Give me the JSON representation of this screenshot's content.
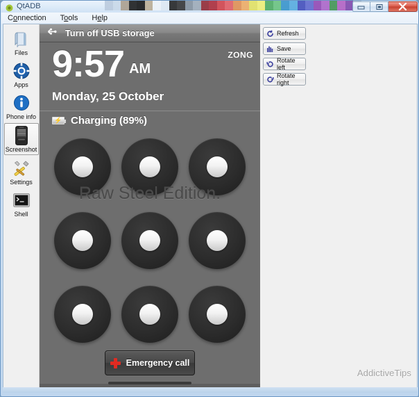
{
  "window": {
    "title": "QtADB",
    "app_icon": "android-icon",
    "controls": [
      {
        "name": "minimize",
        "icon": "minimize-icon"
      },
      {
        "name": "maximize",
        "icon": "maximize-icon"
      },
      {
        "name": "close",
        "icon": "close-icon"
      }
    ],
    "artifact_colors": [
      "#b9c9dc",
      "#c8d8e8",
      "#a89a88",
      "#121212",
      "#0a0a0a",
      "#b8a98f",
      "#eef3f8",
      "#dfe8f2",
      "#1a1a1a",
      "#2b2b2b",
      "#7f8c99",
      "#9aa7b4",
      "#8e1f2a",
      "#a82230",
      "#d03a42",
      "#e0555c",
      "#e08a4a",
      "#eea85c",
      "#e2e05a",
      "#f0ee6e",
      "#46a85a",
      "#63c078",
      "#2f8fc9",
      "#4fa8dd",
      "#3b46b8",
      "#5a63cc",
      "#8e3fb0",
      "#a95ec6",
      "#3a8f4a",
      "#b05ac0",
      "#7a3fa8",
      "#c8cfd8"
    ]
  },
  "menubar": {
    "items": [
      {
        "name": "connection",
        "pre": "C",
        "accel": "o",
        "post": "nnection"
      },
      {
        "name": "tools",
        "pre": "T",
        "accel": "o",
        "post": "ols"
      },
      {
        "name": "help",
        "pre": "H",
        "accel": "e",
        "post": "lp"
      }
    ]
  },
  "sidebar": {
    "items": [
      {
        "label": "Files",
        "icon": "files-icon",
        "selected": false
      },
      {
        "label": "Apps",
        "icon": "apps-icon",
        "selected": false
      },
      {
        "label": "Phone info",
        "icon": "phone-info-icon",
        "selected": false
      },
      {
        "label": "Screenshot",
        "icon": "screenshot-icon",
        "selected": true
      },
      {
        "label": "Settings",
        "icon": "settings-icon",
        "selected": false
      },
      {
        "label": "Shell",
        "icon": "shell-icon",
        "selected": false
      }
    ]
  },
  "toolbar": {
    "buttons": [
      {
        "label": "Refresh",
        "icon": "refresh-icon"
      },
      {
        "label": "Save",
        "icon": "save-icon"
      },
      {
        "label": "Rotate left",
        "icon": "rotate-left-icon"
      },
      {
        "label": "Rotate right",
        "icon": "rotate-right-icon"
      }
    ]
  },
  "phone_screen": {
    "usb_bar": {
      "label": "Turn off USB storage",
      "icon": "usb-icon"
    },
    "carrier": "ZONG",
    "clock": {
      "time": "9:57",
      "ampm": "AM",
      "date": "Monday, 25 October"
    },
    "battery": {
      "label": "Charging (89%)",
      "icon": "battery-charging-icon",
      "bolt": "⚡"
    },
    "rom_watermark": "Raw Steel Edition.",
    "pattern_grid": {
      "rows": 3,
      "cols": 3,
      "dots": [
        1,
        2,
        3,
        4,
        5,
        6,
        7,
        8,
        9
      ]
    },
    "emergency_call": {
      "label": "Emergency call",
      "icon": "red-cross-icon"
    }
  },
  "watermark": "AddictiveTips",
  "colors": {
    "phone_bg": "#6e6e6e",
    "dot_dark": "#2c2c2c",
    "accent_red": "#e02b22",
    "button_blue": "#3b3f9e",
    "chrome": "#f0f0f0"
  }
}
